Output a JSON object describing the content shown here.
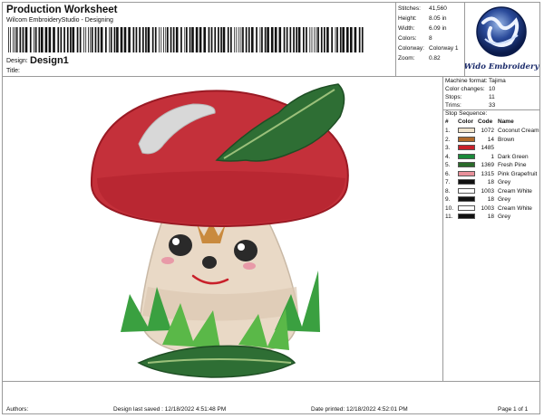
{
  "header": {
    "title": "Production Worksheet",
    "subtitle": "Wilcom EmbroideryStudio - Designing",
    "design_label": "Design:",
    "design_name": "Design1",
    "title_label": "Title:"
  },
  "stats": [
    {
      "label": "Stitches:",
      "value": "41,560"
    },
    {
      "label": "Height:",
      "value": "8.05 in"
    },
    {
      "label": "Width:",
      "value": "6.09 in"
    },
    {
      "label": "Colors:",
      "value": "8"
    },
    {
      "label": "Colorway:",
      "value": "Colorway 1"
    },
    {
      "label": "Zoom:",
      "value": "0.82"
    }
  ],
  "logo": {
    "text": "Wido Embroidery"
  },
  "machine": [
    {
      "label": "Machine format:",
      "value": "Tajima"
    },
    {
      "label": "Color changes:",
      "value": "10"
    },
    {
      "label": "Stops:",
      "value": "11"
    },
    {
      "label": "Trims:",
      "value": "33"
    }
  ],
  "stop_sequence": {
    "label": "Stop Sequence:",
    "headers": {
      "num": "#",
      "color": "Color",
      "code": "Code",
      "name": "Name"
    },
    "rows": [
      {
        "num": "1.",
        "code": "1072",
        "name": "Coconut Cream",
        "color": "#f0e4cc"
      },
      {
        "num": "2.",
        "code": "14",
        "name": "Brown",
        "color": "#b06a2a"
      },
      {
        "num": "3.",
        "code": "1485",
        "name": "",
        "color": "#c8202a"
      },
      {
        "num": "4.",
        "code": "1",
        "name": "Dark Green",
        "color": "#1a8a3a"
      },
      {
        "num": "5.",
        "code": "1369",
        "name": "Fresh Pine",
        "color": "#2a6a2a"
      },
      {
        "num": "6.",
        "code": "1315",
        "name": "Pink Grapefruit",
        "color": "#e8909a"
      },
      {
        "num": "7.",
        "code": "18",
        "name": "Grey",
        "color": "#111111"
      },
      {
        "num": "8.",
        "code": "1003",
        "name": "Cream White",
        "color": "#ffffff"
      },
      {
        "num": "9.",
        "code": "18",
        "name": "Grey",
        "color": "#111111"
      },
      {
        "num": "10.",
        "code": "1003",
        "name": "Cream White",
        "color": "#ffffff"
      },
      {
        "num": "11.",
        "code": "18",
        "name": "Grey",
        "color": "#111111"
      }
    ]
  },
  "footer": {
    "authors": "Authors:",
    "saved": "Design last saved :  12/18/2022 4:51:48 PM",
    "printed": "Date printed: 12/18/2022 4:52:01 PM",
    "page": "Page 1 of 1"
  }
}
